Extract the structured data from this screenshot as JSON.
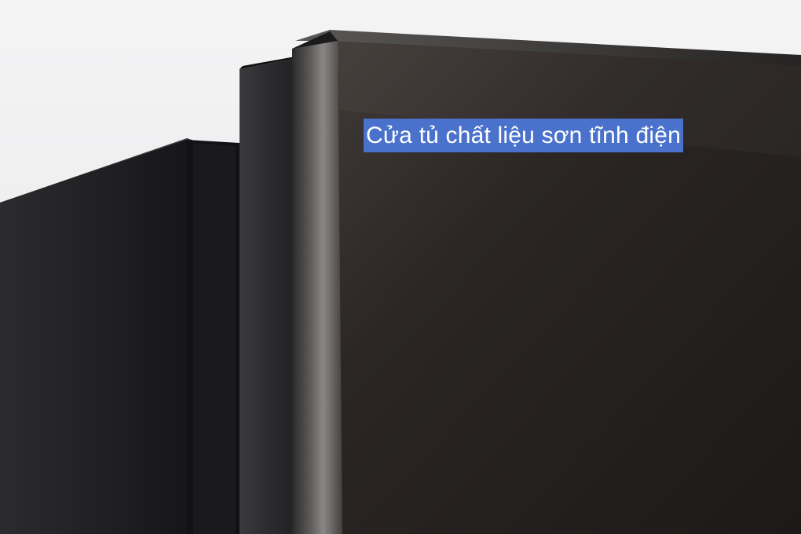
{
  "photo": {
    "subject": "fridge-door-closeup",
    "colors": {
      "background": "#efeff0",
      "door": "#2a2624",
      "caption_bg": "#4a72cc",
      "caption_text": "#ffffff"
    }
  },
  "caption": {
    "text": "Cửa tủ chất liệu sơn tĩnh điện"
  }
}
